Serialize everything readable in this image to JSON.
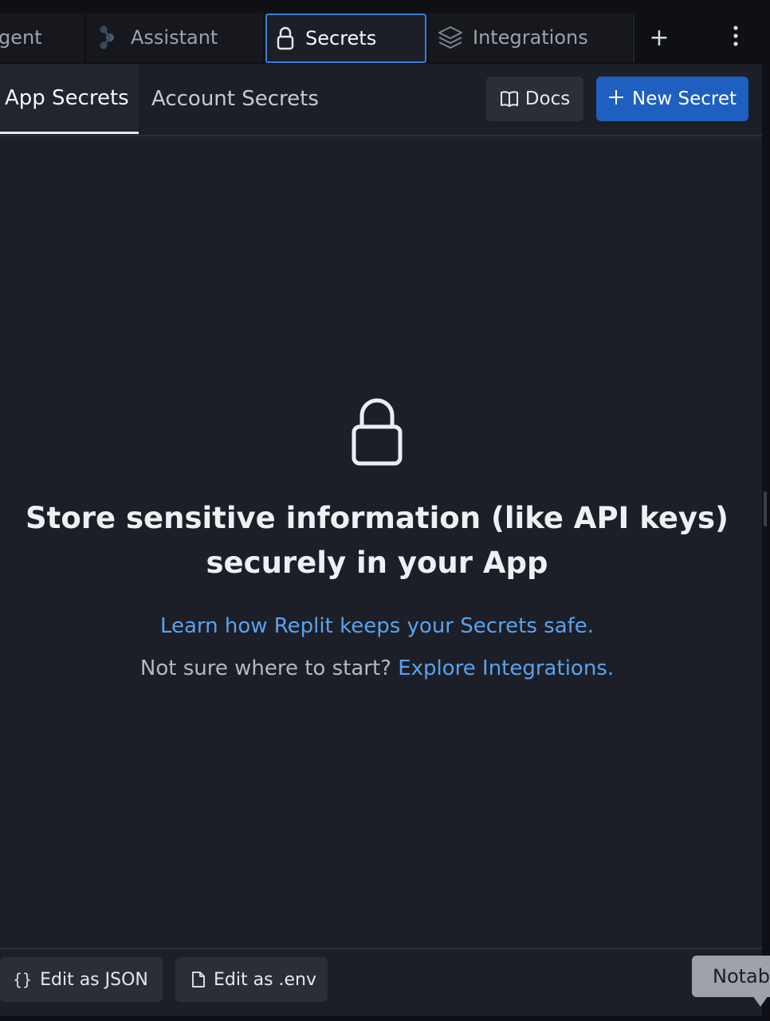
{
  "tabs": [
    {
      "label": "gent",
      "icon": "agent-icon"
    },
    {
      "label": "Assistant",
      "icon": "assistant-icon"
    },
    {
      "label": "Secrets",
      "icon": "lock-icon",
      "active": true
    },
    {
      "label": "Integrations",
      "icon": "layers-icon"
    }
  ],
  "tabbar": {
    "add_label": "+",
    "more_icon": "more-vertical-icon"
  },
  "subtabs": [
    {
      "label": "App Secrets",
      "active": true
    },
    {
      "label": "Account Secrets"
    }
  ],
  "actions": {
    "docs_label": "Docs",
    "docs_icon": "book-icon",
    "new_label": "New Secret",
    "new_icon": "plus-icon"
  },
  "empty_state": {
    "icon": "lock-icon",
    "title_line1": "Store sensitive information (like API keys)",
    "title_line2": "securely in your App",
    "learn_link": "Learn how Replit keeps your Secrets safe.",
    "hint_text": "Not sure where to start?",
    "hint_link": "Explore Integrations."
  },
  "footer": {
    "json_icon_text": "{}",
    "json_label": "Edit as JSON",
    "env_icon": "file-icon",
    "env_label": "Edit as .env"
  },
  "tooltip": {
    "text": "Notab"
  },
  "colors": {
    "background": "#1c1f27",
    "tabbar": "#0e1016",
    "accent_blue": "#1f5fbf",
    "active_border": "#3c7bd8",
    "link": "#5aa2ee"
  }
}
